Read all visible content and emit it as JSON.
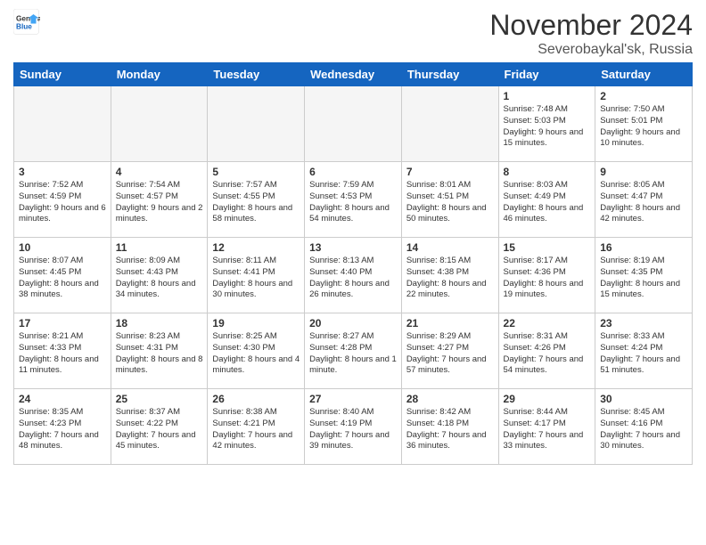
{
  "logo": {
    "line1": "General",
    "line2": "Blue"
  },
  "title": "November 2024",
  "subtitle": "Severobaykal'sk, Russia",
  "weekdays": [
    "Sunday",
    "Monday",
    "Tuesday",
    "Wednesday",
    "Thursday",
    "Friday",
    "Saturday"
  ],
  "weeks": [
    [
      {
        "day": "",
        "info": ""
      },
      {
        "day": "",
        "info": ""
      },
      {
        "day": "",
        "info": ""
      },
      {
        "day": "",
        "info": ""
      },
      {
        "day": "",
        "info": ""
      },
      {
        "day": "1",
        "info": "Sunrise: 7:48 AM\nSunset: 5:03 PM\nDaylight: 9 hours and 15 minutes."
      },
      {
        "day": "2",
        "info": "Sunrise: 7:50 AM\nSunset: 5:01 PM\nDaylight: 9 hours and 10 minutes."
      }
    ],
    [
      {
        "day": "3",
        "info": "Sunrise: 7:52 AM\nSunset: 4:59 PM\nDaylight: 9 hours and 6 minutes."
      },
      {
        "day": "4",
        "info": "Sunrise: 7:54 AM\nSunset: 4:57 PM\nDaylight: 9 hours and 2 minutes."
      },
      {
        "day": "5",
        "info": "Sunrise: 7:57 AM\nSunset: 4:55 PM\nDaylight: 8 hours and 58 minutes."
      },
      {
        "day": "6",
        "info": "Sunrise: 7:59 AM\nSunset: 4:53 PM\nDaylight: 8 hours and 54 minutes."
      },
      {
        "day": "7",
        "info": "Sunrise: 8:01 AM\nSunset: 4:51 PM\nDaylight: 8 hours and 50 minutes."
      },
      {
        "day": "8",
        "info": "Sunrise: 8:03 AM\nSunset: 4:49 PM\nDaylight: 8 hours and 46 minutes."
      },
      {
        "day": "9",
        "info": "Sunrise: 8:05 AM\nSunset: 4:47 PM\nDaylight: 8 hours and 42 minutes."
      }
    ],
    [
      {
        "day": "10",
        "info": "Sunrise: 8:07 AM\nSunset: 4:45 PM\nDaylight: 8 hours and 38 minutes."
      },
      {
        "day": "11",
        "info": "Sunrise: 8:09 AM\nSunset: 4:43 PM\nDaylight: 8 hours and 34 minutes."
      },
      {
        "day": "12",
        "info": "Sunrise: 8:11 AM\nSunset: 4:41 PM\nDaylight: 8 hours and 30 minutes."
      },
      {
        "day": "13",
        "info": "Sunrise: 8:13 AM\nSunset: 4:40 PM\nDaylight: 8 hours and 26 minutes."
      },
      {
        "day": "14",
        "info": "Sunrise: 8:15 AM\nSunset: 4:38 PM\nDaylight: 8 hours and 22 minutes."
      },
      {
        "day": "15",
        "info": "Sunrise: 8:17 AM\nSunset: 4:36 PM\nDaylight: 8 hours and 19 minutes."
      },
      {
        "day": "16",
        "info": "Sunrise: 8:19 AM\nSunset: 4:35 PM\nDaylight: 8 hours and 15 minutes."
      }
    ],
    [
      {
        "day": "17",
        "info": "Sunrise: 8:21 AM\nSunset: 4:33 PM\nDaylight: 8 hours and 11 minutes."
      },
      {
        "day": "18",
        "info": "Sunrise: 8:23 AM\nSunset: 4:31 PM\nDaylight: 8 hours and 8 minutes."
      },
      {
        "day": "19",
        "info": "Sunrise: 8:25 AM\nSunset: 4:30 PM\nDaylight: 8 hours and 4 minutes."
      },
      {
        "day": "20",
        "info": "Sunrise: 8:27 AM\nSunset: 4:28 PM\nDaylight: 8 hours and 1 minute."
      },
      {
        "day": "21",
        "info": "Sunrise: 8:29 AM\nSunset: 4:27 PM\nDaylight: 7 hours and 57 minutes."
      },
      {
        "day": "22",
        "info": "Sunrise: 8:31 AM\nSunset: 4:26 PM\nDaylight: 7 hours and 54 minutes."
      },
      {
        "day": "23",
        "info": "Sunrise: 8:33 AM\nSunset: 4:24 PM\nDaylight: 7 hours and 51 minutes."
      }
    ],
    [
      {
        "day": "24",
        "info": "Sunrise: 8:35 AM\nSunset: 4:23 PM\nDaylight: 7 hours and 48 minutes."
      },
      {
        "day": "25",
        "info": "Sunrise: 8:37 AM\nSunset: 4:22 PM\nDaylight: 7 hours and 45 minutes."
      },
      {
        "day": "26",
        "info": "Sunrise: 8:38 AM\nSunset: 4:21 PM\nDaylight: 7 hours and 42 minutes."
      },
      {
        "day": "27",
        "info": "Sunrise: 8:40 AM\nSunset: 4:19 PM\nDaylight: 7 hours and 39 minutes."
      },
      {
        "day": "28",
        "info": "Sunrise: 8:42 AM\nSunset: 4:18 PM\nDaylight: 7 hours and 36 minutes."
      },
      {
        "day": "29",
        "info": "Sunrise: 8:44 AM\nSunset: 4:17 PM\nDaylight: 7 hours and 33 minutes."
      },
      {
        "day": "30",
        "info": "Sunrise: 8:45 AM\nSunset: 4:16 PM\nDaylight: 7 hours and 30 minutes."
      }
    ]
  ]
}
